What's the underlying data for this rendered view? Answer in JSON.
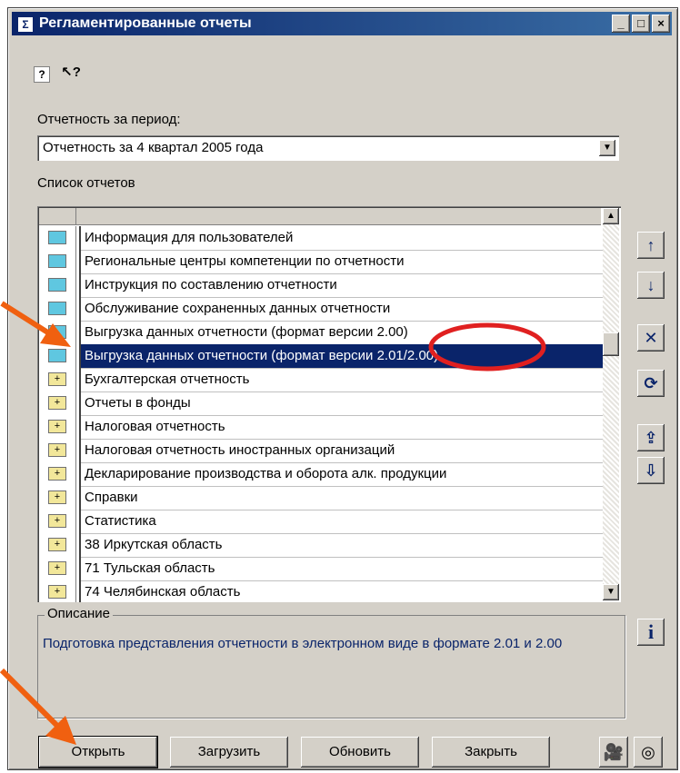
{
  "window": {
    "title": "Регламентированные отчеты",
    "icon": "report-icon",
    "controls": [
      "_",
      "□",
      "×"
    ]
  },
  "toolbar": {
    "help_icon": "?",
    "whats_this_icon": "↖?"
  },
  "period": {
    "label": "Отчетность за период:",
    "selected": "Отчетность за 4 квартал 2005 года"
  },
  "list": {
    "label": "Список отчетов",
    "rows": [
      {
        "text": "Информация для пользователей",
        "icon": "folder-cyan",
        "selected": false
      },
      {
        "text": "Региональные центры компетенции по отчетности",
        "icon": "folder-cyan",
        "selected": false
      },
      {
        "text": "Инструкция по составлению отчетности",
        "icon": "folder-cyan",
        "selected": false
      },
      {
        "text": "Обслуживание сохраненных данных отчетности",
        "icon": "folder-cyan",
        "selected": false
      },
      {
        "text": "Выгрузка данных отчетности (формат версии 2.00)",
        "icon": "folder-cyan",
        "selected": false
      },
      {
        "text": "Выгрузка данных отчетности (формат версии 2.01/2.00)",
        "icon": "folder-cyan",
        "selected": true
      },
      {
        "text": "Бухгалтерская отчетность",
        "icon": "folder-plus",
        "selected": false
      },
      {
        "text": "Отчеты в фонды",
        "icon": "folder-plus",
        "selected": false
      },
      {
        "text": "Налоговая отчетность",
        "icon": "folder-plus",
        "selected": false
      },
      {
        "text": "Налоговая отчетность иностранных организаций",
        "icon": "folder-plus",
        "selected": false
      },
      {
        "text": "Декларирование производства и оборота алк. продукции",
        "icon": "folder-plus",
        "selected": false
      },
      {
        "text": "Справки",
        "icon": "folder-plus",
        "selected": false
      },
      {
        "text": "Статистика",
        "icon": "folder-plus",
        "selected": false
      },
      {
        "text": "38 Иркутская область",
        "icon": "folder-plus",
        "selected": false
      },
      {
        "text": "71 Тульская область",
        "icon": "folder-plus",
        "selected": false
      },
      {
        "text": "74 Челябинская область",
        "icon": "folder-plus",
        "selected": false
      }
    ]
  },
  "side_buttons": [
    "move-up-icon",
    "move-down-icon",
    "delete-icon",
    "refresh-icon",
    "export-icon",
    "import-icon"
  ],
  "description": {
    "label": "Описание",
    "text": "Подготовка представления отчетности в электронном виде в формате 2.01 и 2.00",
    "info_icon": "i"
  },
  "buttons": {
    "open": "Открыть",
    "load": "Загрузить",
    "update": "Обновить",
    "close": "Закрыть"
  },
  "colors": {
    "titlebar": "#0a246a",
    "selection": "#0a246a",
    "highlight_circle": "#e02020",
    "arrow": "#f06010"
  }
}
